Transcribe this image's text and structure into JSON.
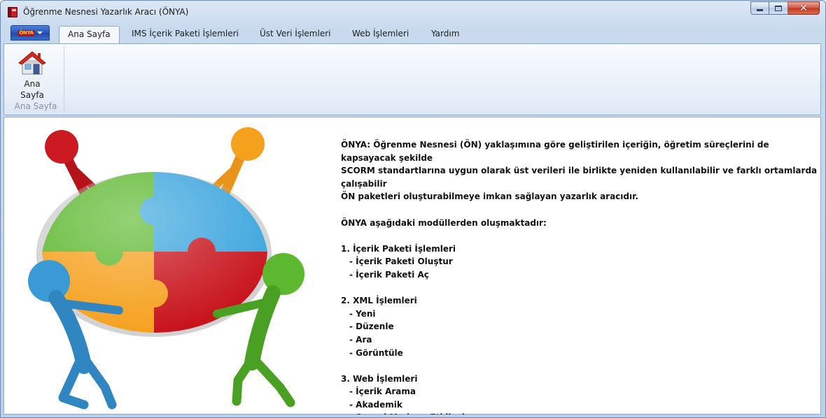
{
  "window": {
    "title": "Öğrenme Nesnesi Yazarlık Aracı (ÖNYA)",
    "close_glyph": "✕"
  },
  "app_menu": {
    "logo": "ÖNYA"
  },
  "tabs": [
    {
      "label": "Ana Sayfa",
      "active": true
    },
    {
      "label": "IMS İçerik Paketi İşlemleri"
    },
    {
      "label": "Üst Veri İşlemleri"
    },
    {
      "label": "Web İşlemleri"
    },
    {
      "label": "Yardım"
    }
  ],
  "ribbon": {
    "group_label": "Ana Sayfa",
    "home_button_line1": "Ana",
    "home_button_line2": "Sayfa",
    "home_icon": "house-icon"
  },
  "content": {
    "intro_1": "ÖNYA: Öğrenme Nesnesi (ÖN) yaklaşımına göre geliştirilen içeriğin, öğretim süreçlerini de kapsayacak şekilde",
    "intro_2": "SCORM standartlarına uygun olarak üst verileri ile birlikte yeniden kullanılabilir ve farklı ortamlarda çalışabilir",
    "intro_3": "ÖN paketleri oluşturabilmeye imkan sağlayan yazarlık aracıdır.",
    "modules_heading": "ÖNYA aşağıdaki modüllerden oluşmaktadır:",
    "modules": [
      {
        "title": "1. İçerik Paketi İşlemleri",
        "items": [
          "- İçerik Paketi Oluştur",
          "- İçerik Paketi Aç"
        ]
      },
      {
        "title": "2. XML İşlemleri",
        "items": [
          "- Yeni",
          "- Düzenle",
          "- Ara",
          "- Görüntüle"
        ]
      },
      {
        "title": "3. Web İşlemleri",
        "items": [
          "- İçerik Arama",
          "- Akademik",
          "- Sosyal Medya - Etkileşim"
        ]
      }
    ]
  },
  "colors": {
    "puzzle_green": "#5cb82e",
    "puzzle_blue": "#3aa5dd",
    "puzzle_orange": "#f5a11e",
    "puzzle_red": "#c8141c"
  }
}
